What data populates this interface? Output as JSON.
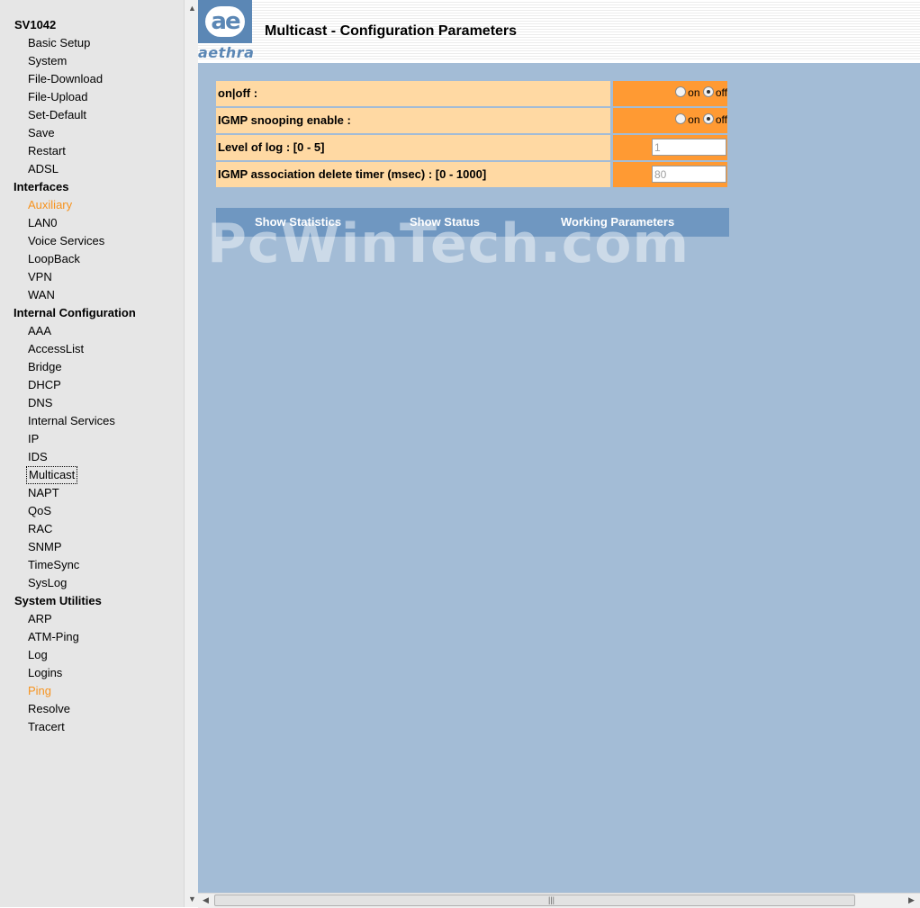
{
  "nav": {
    "device": "SV1042",
    "groups": [
      {
        "title": "",
        "items": [
          "Basic Setup",
          "System",
          "File-Download",
          "File-Upload",
          "Set-Default",
          "Save",
          "Restart",
          "ADSL"
        ]
      },
      {
        "title": "Interfaces",
        "items": [
          "Auxiliary",
          "LAN0",
          "Voice Services",
          "LoopBack",
          "VPN",
          "WAN"
        ]
      },
      {
        "title": "Internal Configuration",
        "items": [
          "AAA",
          "AccessList",
          "Bridge",
          "DHCP",
          "DNS",
          "Internal Services",
          "IP",
          "IDS",
          "Multicast",
          "NAPT",
          "QoS",
          "RAC",
          "SNMP",
          "TimeSync",
          "SysLog"
        ]
      },
      {
        "title": "System Utilities",
        "items": [
          "ARP",
          "ATM-Ping",
          "Log",
          "Logins",
          "Ping",
          "Resolve",
          "Tracert"
        ]
      }
    ],
    "highlighted": [
      "Auxiliary",
      "Ping"
    ],
    "selected": "Multicast",
    "highlight_color": "#f7931e"
  },
  "header": {
    "logo_mark": "ae",
    "logo_word": "aethra",
    "title": "Multicast - Configuration Parameters"
  },
  "config": {
    "rows": [
      {
        "label": "on|off :",
        "type": "radio",
        "on_label": "on",
        "off_label": "off",
        "selected": "off"
      },
      {
        "label": "IGMP snooping enable :",
        "type": "radio",
        "on_label": "on",
        "off_label": "off",
        "selected": "off"
      },
      {
        "label": "Level of log : [0 - 5]",
        "type": "text",
        "value": "1"
      },
      {
        "label": "IGMP association delete timer (msec) : [0 - 1000]",
        "type": "text",
        "value": "80"
      }
    ]
  },
  "links": {
    "show_statistics": "Show Statistics",
    "show_status": "Show Status",
    "working_parameters": "Working Parameters"
  },
  "watermark": "PcWinTech.com",
  "colors": {
    "main_bg": "#a3bcd6",
    "label_bg": "#ffd9a3",
    "value_bg": "#ff9a33",
    "linkbar_bg": "#6f97c1",
    "logo_blue": "#5b87b5"
  }
}
